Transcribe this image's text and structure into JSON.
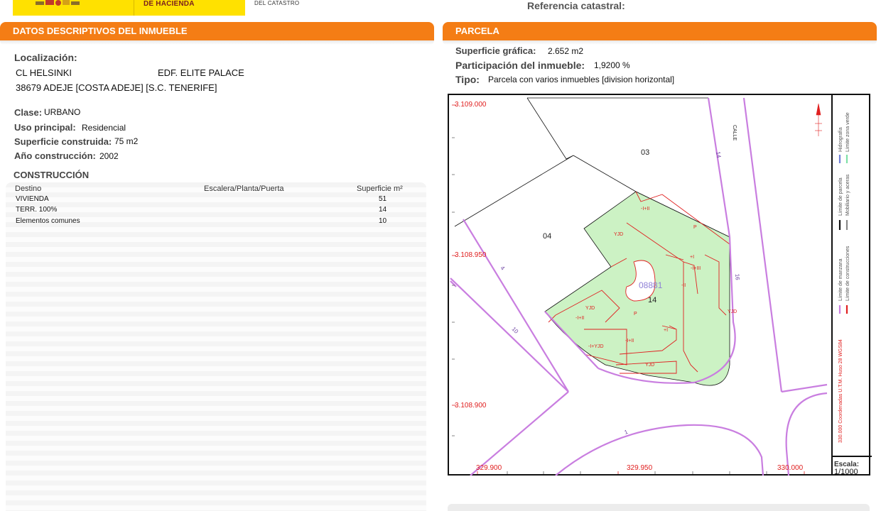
{
  "header": {
    "org_line1": "DE HACIENDA",
    "org_line2": "DEL CATASTRO",
    "reference_label": "Referencia catastral:"
  },
  "datos": {
    "section_title": "DATOS DESCRIPTIVOS DEL INMUEBLE",
    "localizacion_label": "Localización:",
    "street": "CL HELSINKI",
    "building": "EDF. ELITE PALACE",
    "city_line": "38679 ADEJE [COSTA ADEJE] [S.C. TENERIFE]",
    "clase_label": "Clase:",
    "clase_value": "URBANO",
    "uso_label": "Uso principal:",
    "uso_value": "Residencial",
    "superficie_label": "Superficie construida:",
    "superficie_value": "75 m2",
    "anio_label": "Año construcción:",
    "anio_value": "2002"
  },
  "construccion": {
    "title": "CONSTRUCCIÓN",
    "headers": [
      "Destino",
      "Escalera/Planta/Puerta",
      "Superficie m²"
    ],
    "rows": [
      {
        "destino": "VIVIENDA",
        "superficie": "51"
      },
      {
        "destino": "TERR. 100%",
        "superficie": "14"
      },
      {
        "destino": "Elementos comunes",
        "superficie": "10"
      }
    ]
  },
  "parcela": {
    "section_title": "PARCELA",
    "superficie_label": "Superficie gráfica:",
    "superficie_value": "2.652 m2",
    "participacion_label": "Participación del inmueble:",
    "participacion_value": "1,9200 %",
    "tipo_label": "Tipo:",
    "tipo_value": "Parcela con varios inmuebles [division horizontal]"
  },
  "map": {
    "y_coords": [
      "3.109.000",
      "3.108.950",
      "3.108.900"
    ],
    "x_coords": [
      "329.900",
      "329.950",
      "330.000"
    ],
    "parcel_labels": [
      "03",
      "04",
      "14"
    ],
    "parcel_ref": "08881",
    "street_numbers": [
      "14",
      "16",
      "4",
      "10",
      "1"
    ],
    "street_name": "CALLE",
    "building_labels": {
      "yjd": "YJD",
      "p": "P",
      "i_ii": "-I+II",
      "ii": "-II",
      "i_yjd": "-I+YJD",
      "plus_i": "+I",
      "i_iii": "-I+III"
    },
    "legend_col1": [
      "Límite de manzana",
      "Límite de parcela",
      "Hidrografía"
    ],
    "legend_col2": [
      "Límite de construcciones",
      "Mobiliario y aceras",
      "Límite zona verde"
    ],
    "coord_note": "330.000 Coordenadas U.T.M. Huso 28 WGS84",
    "scale_label": "Escala:",
    "scale_value": "1/1000",
    "colors": {
      "manzana": "#c97ee0",
      "construcciones": "#e02020",
      "parcela": "#111111",
      "mobiliario": "#888888",
      "hidrografia": "#6f7fd6",
      "zona_verde": "#7fe0a8",
      "green_fill": "#ccf2c4"
    }
  },
  "colors": {
    "accent": "#f47d15",
    "logo": "#ffe100"
  }
}
